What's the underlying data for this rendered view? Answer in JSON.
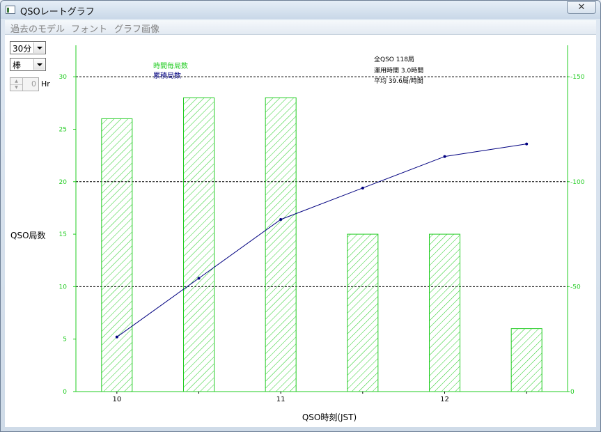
{
  "window": {
    "title": "QSOレートグラフ",
    "close_glyph": "✕"
  },
  "menu": [
    "過去のモデル",
    "フォント",
    "グラフ画像"
  ],
  "controls": {
    "interval": "30分",
    "chart_style": "棒",
    "hours_value": "0",
    "hours_unit": "Hr"
  },
  "stats": [
    "全QSO 118局",
    "運用時間 3.0時間",
    "平均 39.6局/時間"
  ],
  "colors": {
    "bar": "#22cc22",
    "line": "#000080",
    "axis": "#22cc22",
    "text": "#000000"
  },
  "chart_data": {
    "type": "bar+line",
    "xlabel": "QSO時刻(JST)",
    "ylabel": "QSO局数",
    "x_tick_labels": [
      "10",
      "11",
      "12"
    ],
    "y_left_range": [
      0,
      33
    ],
    "y_left_ticks": [
      0,
      5,
      10,
      15,
      20,
      25,
      30
    ],
    "y_right_range": [
      0,
      165
    ],
    "y_right_ticks": [
      0,
      50,
      100,
      150
    ],
    "y_right_tick_labels": [
      "0",
      "-50",
      "-100",
      "-150"
    ],
    "legend": [
      "時間毎局数",
      "累積局数"
    ],
    "bar_values": [
      26,
      28,
      28,
      15,
      15,
      6
    ],
    "cumulative_values": [
      26,
      54,
      82,
      97,
      112,
      118
    ],
    "gridlines_left": [
      10,
      20,
      30
    ]
  }
}
